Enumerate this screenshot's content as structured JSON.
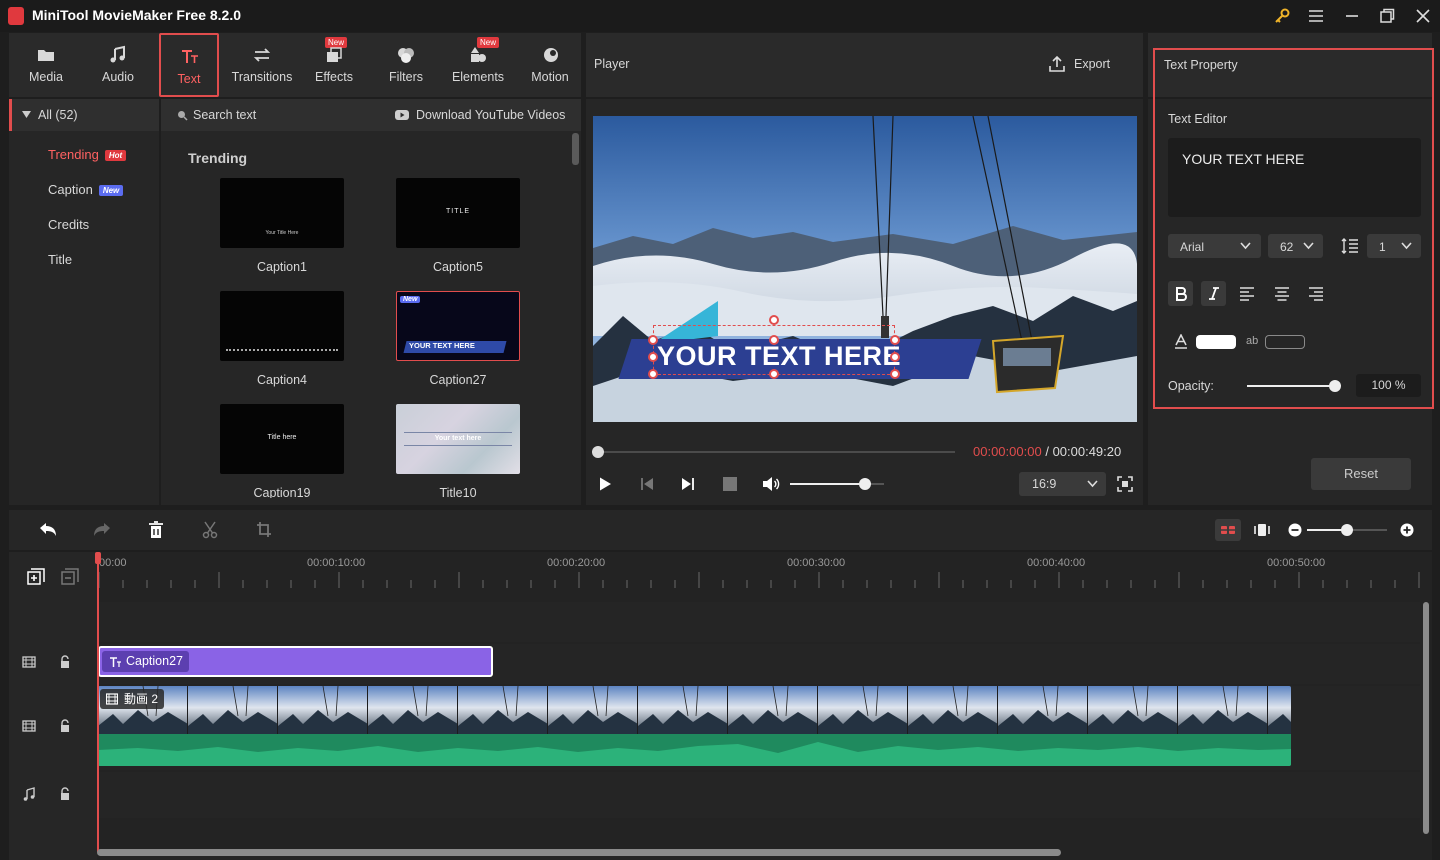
{
  "app": {
    "title": "MiniTool MovieMaker Free 8.2.0"
  },
  "tabs": [
    {
      "label": "Media",
      "icon": "folder-icon"
    },
    {
      "label": "Audio",
      "icon": "music-note-icon"
    },
    {
      "label": "Text",
      "icon": "text-icon",
      "active": true
    },
    {
      "label": "Transitions",
      "icon": "swap-arrows-icon"
    },
    {
      "label": "Effects",
      "icon": "effects-icon",
      "badge": "New"
    },
    {
      "label": "Filters",
      "icon": "filters-icon"
    },
    {
      "label": "Elements",
      "icon": "elements-icon",
      "badge": "New"
    },
    {
      "label": "Motion",
      "icon": "motion-icon"
    }
  ],
  "categories": {
    "all_label": "All (52)",
    "items": [
      {
        "label": "Trending",
        "badge": "Hot",
        "active": true
      },
      {
        "label": "Caption",
        "badge": "New"
      },
      {
        "label": "Credits"
      },
      {
        "label": "Title"
      }
    ]
  },
  "library": {
    "search_placeholder": "Search text",
    "download_label": "Download YouTube Videos",
    "section_title": "Trending",
    "items": [
      {
        "label": "Caption1",
        "preview_text": "Your Title Here"
      },
      {
        "label": "Caption5",
        "preview_text": "TITLE"
      },
      {
        "label": "Caption4",
        "preview_text": ""
      },
      {
        "label": "Caption27",
        "preview_text": "YOUR TEXT HERE",
        "badge": "New"
      },
      {
        "label": "Caption19",
        "preview_text": "Title here"
      },
      {
        "label": "Title10",
        "preview_text": "Your text here"
      }
    ]
  },
  "player": {
    "title": "Player",
    "export_label": "Export",
    "overlay_text": "YOUR TEXT HERE",
    "current_time": "00:00:00:00",
    "separator": "/",
    "total_time": "00:00:49:20",
    "aspect_ratio": "16:9",
    "progress": 0.0,
    "volume": 0.8
  },
  "text_property": {
    "title": "Text Property",
    "editor_label": "Text Editor",
    "editor_value": "YOUR TEXT HERE",
    "font": "Arial",
    "size": "62",
    "line_spacing": "1",
    "opacity_label": "Opacity:",
    "opacity_value": "100 %",
    "opacity": 1.0,
    "text_color": "#ffffff",
    "bg_label": "ab",
    "reset_label": "Reset"
  },
  "timeline": {
    "ruler": [
      "00:00",
      "00:00:10:00",
      "00:00:20:00",
      "00:00:30:00",
      "00:00:40:00",
      "00:00:50:00"
    ],
    "text_clip": "Caption27",
    "video_clip": "動画 2",
    "zoom": 0.5
  },
  "colors": {
    "accent": "#e14d4d",
    "text_clip": "#8a63e6",
    "audio_wave": "#1f8a5e"
  }
}
